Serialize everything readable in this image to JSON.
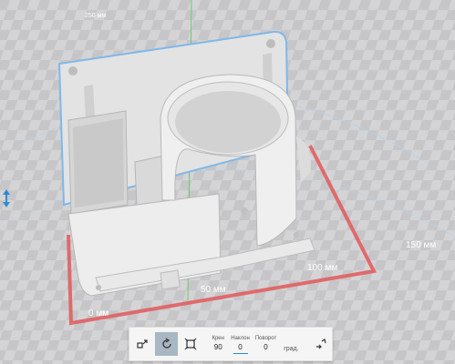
{
  "bed": {
    "axis_labels": {
      "y_top": "250 мм",
      "y_right": "150 мм",
      "x_100": "100 мм",
      "x_50": "50 мм",
      "x_0": "0 мм"
    },
    "colors": {
      "bed_background": "#cfcfd1",
      "grid_line": "#b9b9bb",
      "bed_border": "#e2585a",
      "model": "#e8e8e8",
      "selection_outline": "#7fb8e8",
      "vertical_axis": "#6ec96e",
      "x_axis_marker": "#2e8bd6"
    }
  },
  "toolbar": {
    "buttons": [
      {
        "name": "move-tool-button",
        "icon": "move-icon",
        "active": false
      },
      {
        "name": "rotate-tool-button",
        "icon": "rotate-icon",
        "active": true
      },
      {
        "name": "scale-tool-button",
        "icon": "scale-icon",
        "active": false
      }
    ],
    "fields": {
      "roll": {
        "label": "Крен",
        "value": "90"
      },
      "pitch": {
        "label": "Наклон",
        "value": "0"
      },
      "yaw": {
        "label": "Поворот",
        "value": "0"
      }
    },
    "unit": "град.",
    "extra_button_icon": "lay-flat-icon"
  }
}
